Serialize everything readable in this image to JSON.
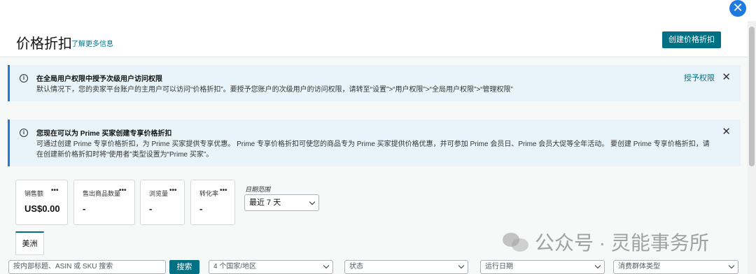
{
  "window": {
    "close_glyph": "✕"
  },
  "header": {
    "title": "价格折扣",
    "learn_more": "了解更多信息",
    "create_button": "创建价格折扣"
  },
  "banner_permission": {
    "title": "在全局用户权限中授予次级用户访问权限",
    "body": "默认情况下，您的卖家平台账户的主用户可以访问“价格折扣”。要授予您账户的次级用户的访问权限，请转至“设置”>“用户权限”>“全局用户权限”>“管理权限”",
    "action": "授予权限",
    "close": "✕"
  },
  "banner_prime": {
    "title": "您现在可以为 Prime 买家创建专享价格折扣",
    "body": "可通过创建 Prime 专享价格折扣，为 Prime 买家提供专享优惠。 Prime 专享价格折扣可使您的商品专为 Prime 买家提供价格优惠，并可参加 Prime 会员日、Prime 会员大促等全年活动。 要创建 Prime 专享价格折扣，请在创建新价格折扣时将“使用者”类型设置为“Prime 买家”。",
    "close": "✕"
  },
  "metrics": [
    {
      "label": "销售额",
      "dots": "•••",
      "value": "US$0.00"
    },
    {
      "label": "售出商品数量",
      "dots": "•••",
      "value": "-"
    },
    {
      "label": "浏览量",
      "dots": "•••",
      "value": "-"
    },
    {
      "label": "转化率",
      "dots": "•••",
      "value": "-"
    }
  ],
  "date_range": {
    "label": "日期范围",
    "selected": "最近 7 天"
  },
  "tabs": [
    {
      "label": "美洲"
    }
  ],
  "filters": {
    "search_placeholder": "按内部标题、ASIN 或 SKU 搜索",
    "search_button": "搜索",
    "country": "4 个国家/地区",
    "status": "状态",
    "run_date": "运行日期",
    "audience": "消费群体类型"
  },
  "watermark": {
    "text": "公众号 · 灵能事务所"
  },
  "colors": {
    "accent": "#007185",
    "close_circle": "#1f7ae0",
    "banner_bg": "#e8f4fa"
  }
}
